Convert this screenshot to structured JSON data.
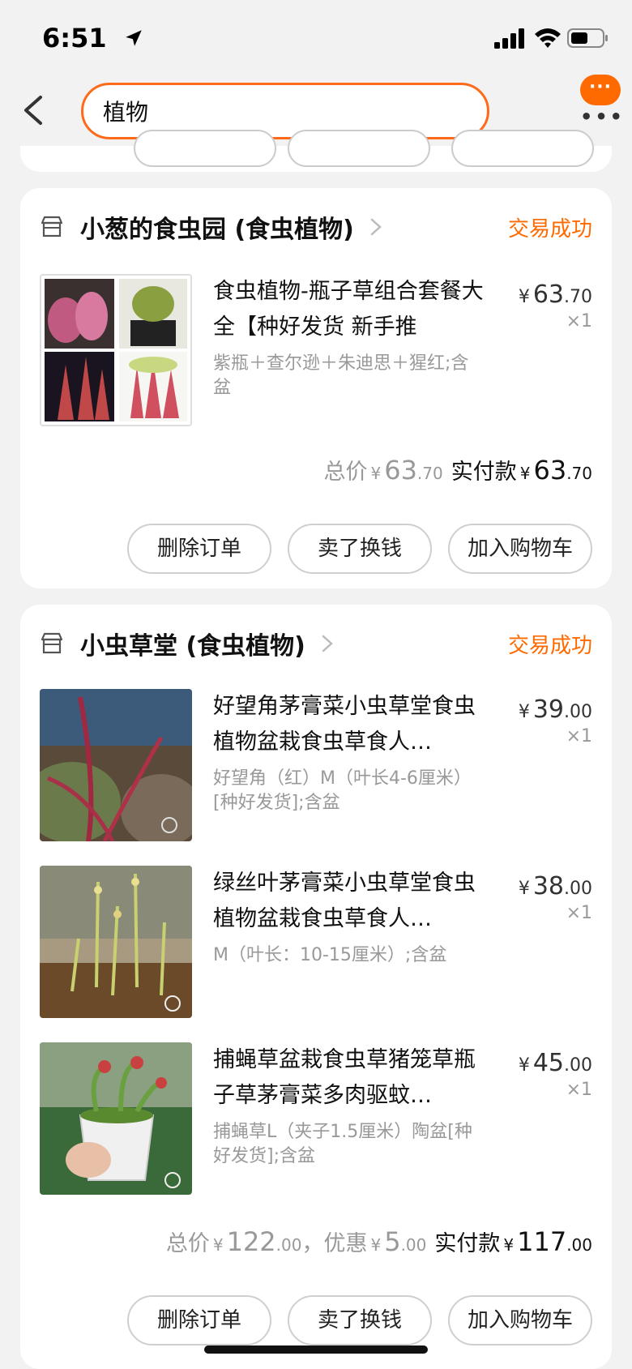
{
  "status_bar": {
    "time": "6:51"
  },
  "search": {
    "query": "植物"
  },
  "orders": [
    {
      "shop_name": "小葱的食虫园 (食虫植物)",
      "status": "交易成功",
      "items": [
        {
          "title": "食虫植物-瓶子草组合套餐大全【种好发货 新手推",
          "spec": "紫瓶＋查尔逊＋朱迪思＋猩红;含盆",
          "price_currency": "¥",
          "price_int": "63",
          "price_dec": ".70",
          "qty": "×1"
        }
      ],
      "totals": {
        "total_label": "总价",
        "currency": "¥",
        "total_int": "63",
        "total_dec": ".70",
        "paid_label": "实付款",
        "paid_int": "63",
        "paid_dec": ".70"
      },
      "buttons": {
        "delete": "删除订单",
        "resell": "卖了换钱",
        "add_cart": "加入购物车"
      }
    },
    {
      "shop_name": "小虫草堂 (食虫植物)",
      "status": "交易成功",
      "items": [
        {
          "title": "好望角茅膏菜小虫草堂食虫植物盆栽食虫草食人…",
          "spec": "好望角（红）M（叶长4-6厘米）[种好发货];含盆",
          "price_currency": "¥",
          "price_int": "39",
          "price_dec": ".00",
          "qty": "×1"
        },
        {
          "title": "绿丝叶茅膏菜小虫草堂食虫植物盆栽食虫草食人…",
          "spec": "M（叶长：10-15厘米）;含盆",
          "price_currency": "¥",
          "price_int": "38",
          "price_dec": ".00",
          "qty": "×1"
        },
        {
          "title": "捕蝇草盆栽食虫草猪笼草瓶子草茅膏菜多肉驱蚊…",
          "spec": "捕蝇草L（夹子1.5厘米）陶盆[种好发货];含盆",
          "price_currency": "¥",
          "price_int": "45",
          "price_dec": ".00",
          "qty": "×1"
        }
      ],
      "totals": {
        "total_label": "总价",
        "currency": "¥",
        "total_int": "122",
        "total_dec": ".00",
        "discount_label": "，优惠",
        "discount_int": "5",
        "discount_dec": ".00",
        "paid_label": "实付款",
        "paid_int": "117",
        "paid_dec": ".00"
      },
      "buttons": {
        "delete": "删除订单",
        "resell": "卖了换钱",
        "add_cart": "加入购物车"
      }
    }
  ],
  "colors": {
    "accent": "#ff6a00",
    "background": "#f2f2f2"
  },
  "icons": [
    "back-arrow-icon",
    "more-icon",
    "shop-icon",
    "chevron-right-icon",
    "location-arrow-icon",
    "signal-icon",
    "wifi-icon",
    "battery-icon"
  ]
}
